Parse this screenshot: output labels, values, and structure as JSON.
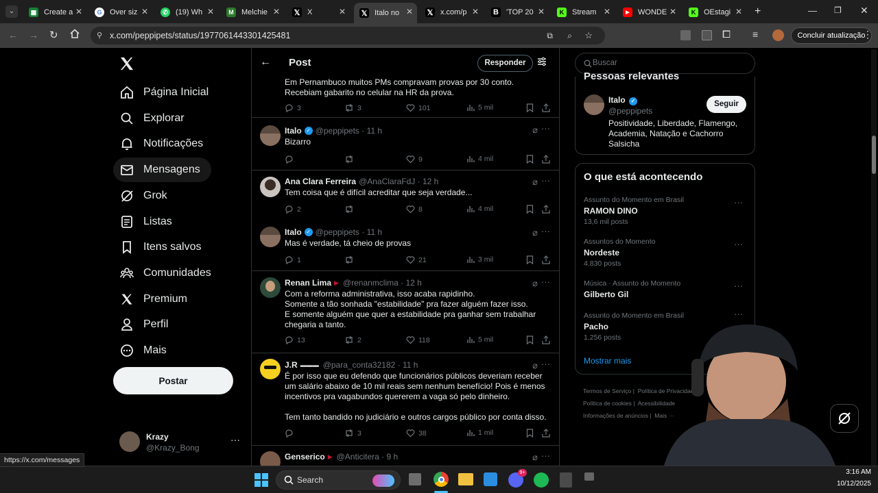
{
  "browser": {
    "tabs": [
      {
        "label": "Create a",
        "color": "#188038",
        "icon": "sheets-icon"
      },
      {
        "label": "Over siz",
        "color": "#ffffff",
        "icon": "google-icon"
      },
      {
        "label": "(19) Wh",
        "color": "#25d366",
        "icon": "whatsapp-icon"
      },
      {
        "label": "Melchie",
        "color": "#2b7a2b",
        "icon": "melchie-icon"
      },
      {
        "label": "X",
        "color": "#000000",
        "icon": "x-icon"
      },
      {
        "label": "Italo no",
        "color": "#000000",
        "icon": "x-icon"
      },
      {
        "label": "x.com/p",
        "color": "#000000",
        "icon": "x-icon"
      },
      {
        "label": "'TOP 20",
        "color": "#000000",
        "icon": "b-icon"
      },
      {
        "label": "Stream",
        "color": "#53fc18",
        "icon": "kick-icon"
      },
      {
        "label": "WONDE",
        "color": "#ff0000",
        "icon": "youtube-icon"
      },
      {
        "label": "OEstagi",
        "color": "#53fc18",
        "icon": "kick-icon"
      }
    ],
    "url": "x.com/peppipets/status/1977061443301425481",
    "update_button": "Concluir atualização",
    "status_url": "https://x.com/messages"
  },
  "sidebar": {
    "items": [
      {
        "label": "Página Inicial",
        "icon": "home-icon"
      },
      {
        "label": "Explorar",
        "icon": "search-icon"
      },
      {
        "label": "Notificações",
        "icon": "bell-icon"
      },
      {
        "label": "Mensagens",
        "icon": "mail-icon"
      },
      {
        "label": "Grok",
        "icon": "grok-icon"
      },
      {
        "label": "Listas",
        "icon": "list-icon"
      },
      {
        "label": "Itens salvos",
        "icon": "bookmark-icon"
      },
      {
        "label": "Comunidades",
        "icon": "communities-icon"
      },
      {
        "label": "Premium",
        "icon": "x-logo-icon"
      },
      {
        "label": "Perfil",
        "icon": "person-icon"
      },
      {
        "label": "Mais",
        "icon": "more-circle-icon"
      }
    ],
    "post_button": "Postar",
    "account": {
      "name": "Krazy",
      "handle": "@Krazy_Bong"
    }
  },
  "header": {
    "title": "Post",
    "reply_button": "Responder"
  },
  "tweets": [
    {
      "name": "",
      "handle": "",
      "time": "",
      "text": "Em Pernambuco muitos PMs compravam provas por 30 conto. Recebiam gabarito no celular na HR da prova.",
      "replies": "3",
      "retweets": "3",
      "likes": "101",
      "views": "5 mil"
    },
    {
      "name": "Italo",
      "handle": "@peppipets",
      "time": "11 h",
      "text": "Bizarro",
      "replies": "",
      "retweets": "",
      "likes": "9",
      "views": "4 mil"
    },
    {
      "name": "Ana Clara Ferreira",
      "handle": "@AnaClaraFdJ",
      "time": "12 h",
      "text": "Tem coisa que é difícil acreditar que seja verdade...",
      "replies": "2",
      "retweets": "",
      "likes": "8",
      "views": "4 mil"
    },
    {
      "name": "Italo",
      "handle": "@peppipets",
      "time": "11 h",
      "text": "Mas é verdade, tá cheio de provas",
      "replies": "1",
      "retweets": "",
      "likes": "21",
      "views": "3 mil"
    },
    {
      "name": "Renan Lima",
      "handle": "@renanmclima",
      "time": "12 h",
      "text_lines": [
        "Com a reforma administrativa, isso acaba rapidinho.",
        "Somente a tão sonhada \"estabilidade\" pra fazer alguém fazer isso.",
        "E somente alguém que quer a estabilidade pra ganhar sem trabalhar chegaria a tanto."
      ],
      "replies": "13",
      "retweets": "2",
      "likes": "118",
      "views": "5 mil"
    },
    {
      "name": "J.R",
      "handle": "@para_conta32182",
      "time": "11 h",
      "text_lines": [
        "É por isso que eu defendo que funcionários públicos deveriam receber um salário abaixo de 10 mil reais sem nenhum benefício! Pois é menos incentivos pra vagabundos quererem a vaga só pelo dinheiro.",
        "Tem tanto bandido no judiciário e outros cargos público por conta disso."
      ],
      "replies": "",
      "retweets": "3",
      "likes": "38",
      "views": "1 mil"
    },
    {
      "name": "Genserico",
      "handle": "@Anticitera",
      "time": "9 h",
      "text": "",
      "replies": "",
      "retweets": "",
      "likes": "",
      "views": ""
    }
  ],
  "right": {
    "search_placeholder": "Buscar",
    "relevant_title": "Pessoas relevantes",
    "relevant_user": {
      "name": "Italo",
      "handle": "@peppipets",
      "bio": "Positividade, Liberdade, Flamengo, Academia, Natação e Cachorro Salsicha",
      "follow_button": "Seguir"
    },
    "trending_title": "O que está acontecendo",
    "trends": [
      {
        "category": "Assunto do Momento em Brasil",
        "name": "RAMON DINO",
        "count": "13,6 mil posts"
      },
      {
        "category": "Assuntos do Momento",
        "name": "Nordeste",
        "count": "4.830 posts"
      },
      {
        "category": "Música · Assunto do Momento",
        "name": "Gilberto Gil",
        "count": ""
      },
      {
        "category": "Assunto do Momento em Brasil",
        "name": "Pacho",
        "count": "1.256 posts"
      }
    ],
    "show_more": "Mostrar mais",
    "footer_links": [
      "Termos de Serviço",
      "Política de Privacidade",
      "Política de cookies",
      "Acessibilidade",
      "Informações de anúncios",
      "Mais ···"
    ]
  },
  "taskbar": {
    "search_label": "Search",
    "time": "3:16 AM",
    "date": "10/12/2025",
    "discord_badge": "9+"
  },
  "colors": {
    "accent": "#1d9bf0",
    "border": "#2f3336",
    "muted": "#71767b"
  }
}
